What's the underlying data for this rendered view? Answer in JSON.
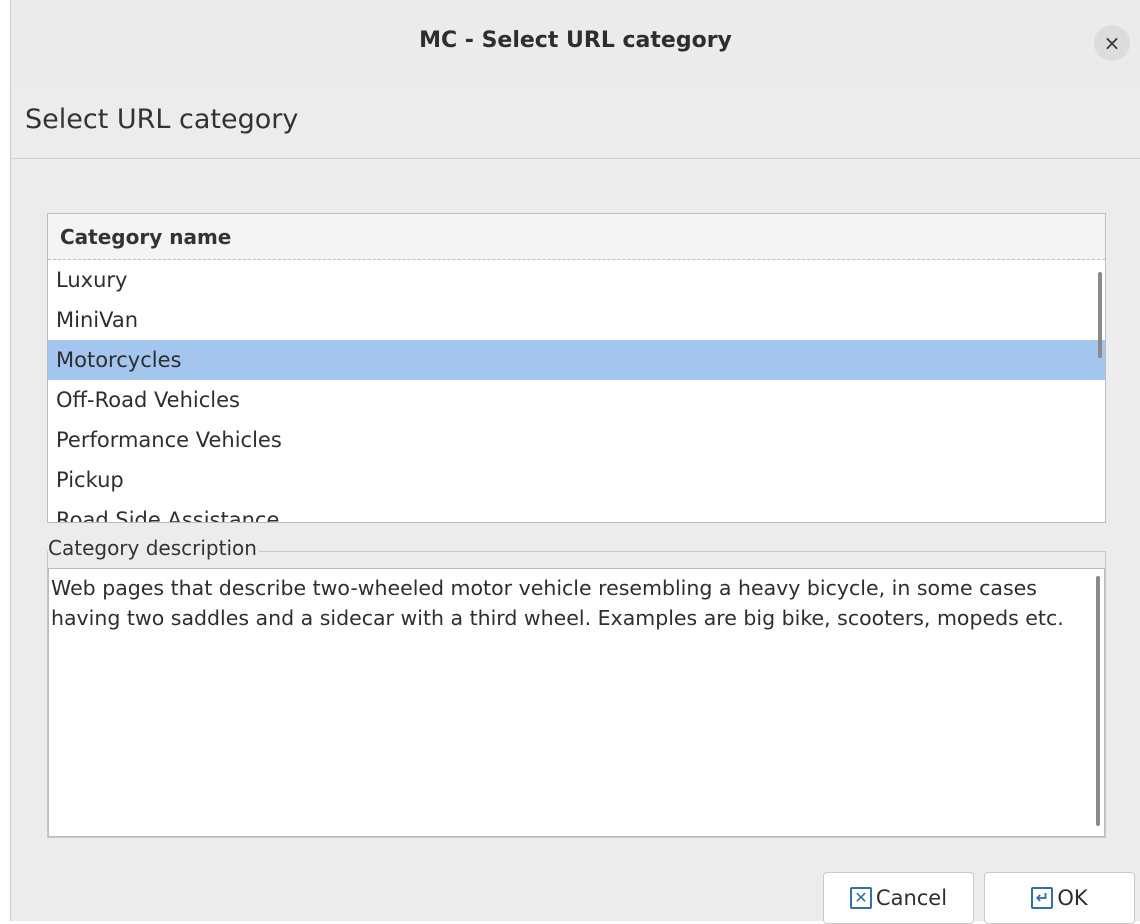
{
  "window": {
    "title": "MC - Select URL category",
    "close_glyph": "×"
  },
  "header": {
    "title": "Select URL category"
  },
  "category_list": {
    "column_header": "Category name",
    "items": [
      "Luxury",
      "MiniVan",
      "Motorcycles",
      "Off-Road Vehicles",
      "Performance Vehicles",
      "Pickup",
      "Road Side Assistance"
    ],
    "selected": "Motorcycles"
  },
  "description": {
    "label": "Category description",
    "text": "Web pages that describe two-wheeled motor vehicle resembling a heavy bicycle, in some cases having two saddles and a sidecar with a third wheel. Examples are big bike, scooters, mopeds etc."
  },
  "buttons": {
    "cancel_label": "Cancel",
    "cancel_icon": "x-box-icon",
    "ok_label": "OK",
    "ok_icon": "enter-icon"
  },
  "colors": {
    "selection": "#a4c5ee",
    "icon_accent": "#2f6fb8"
  }
}
